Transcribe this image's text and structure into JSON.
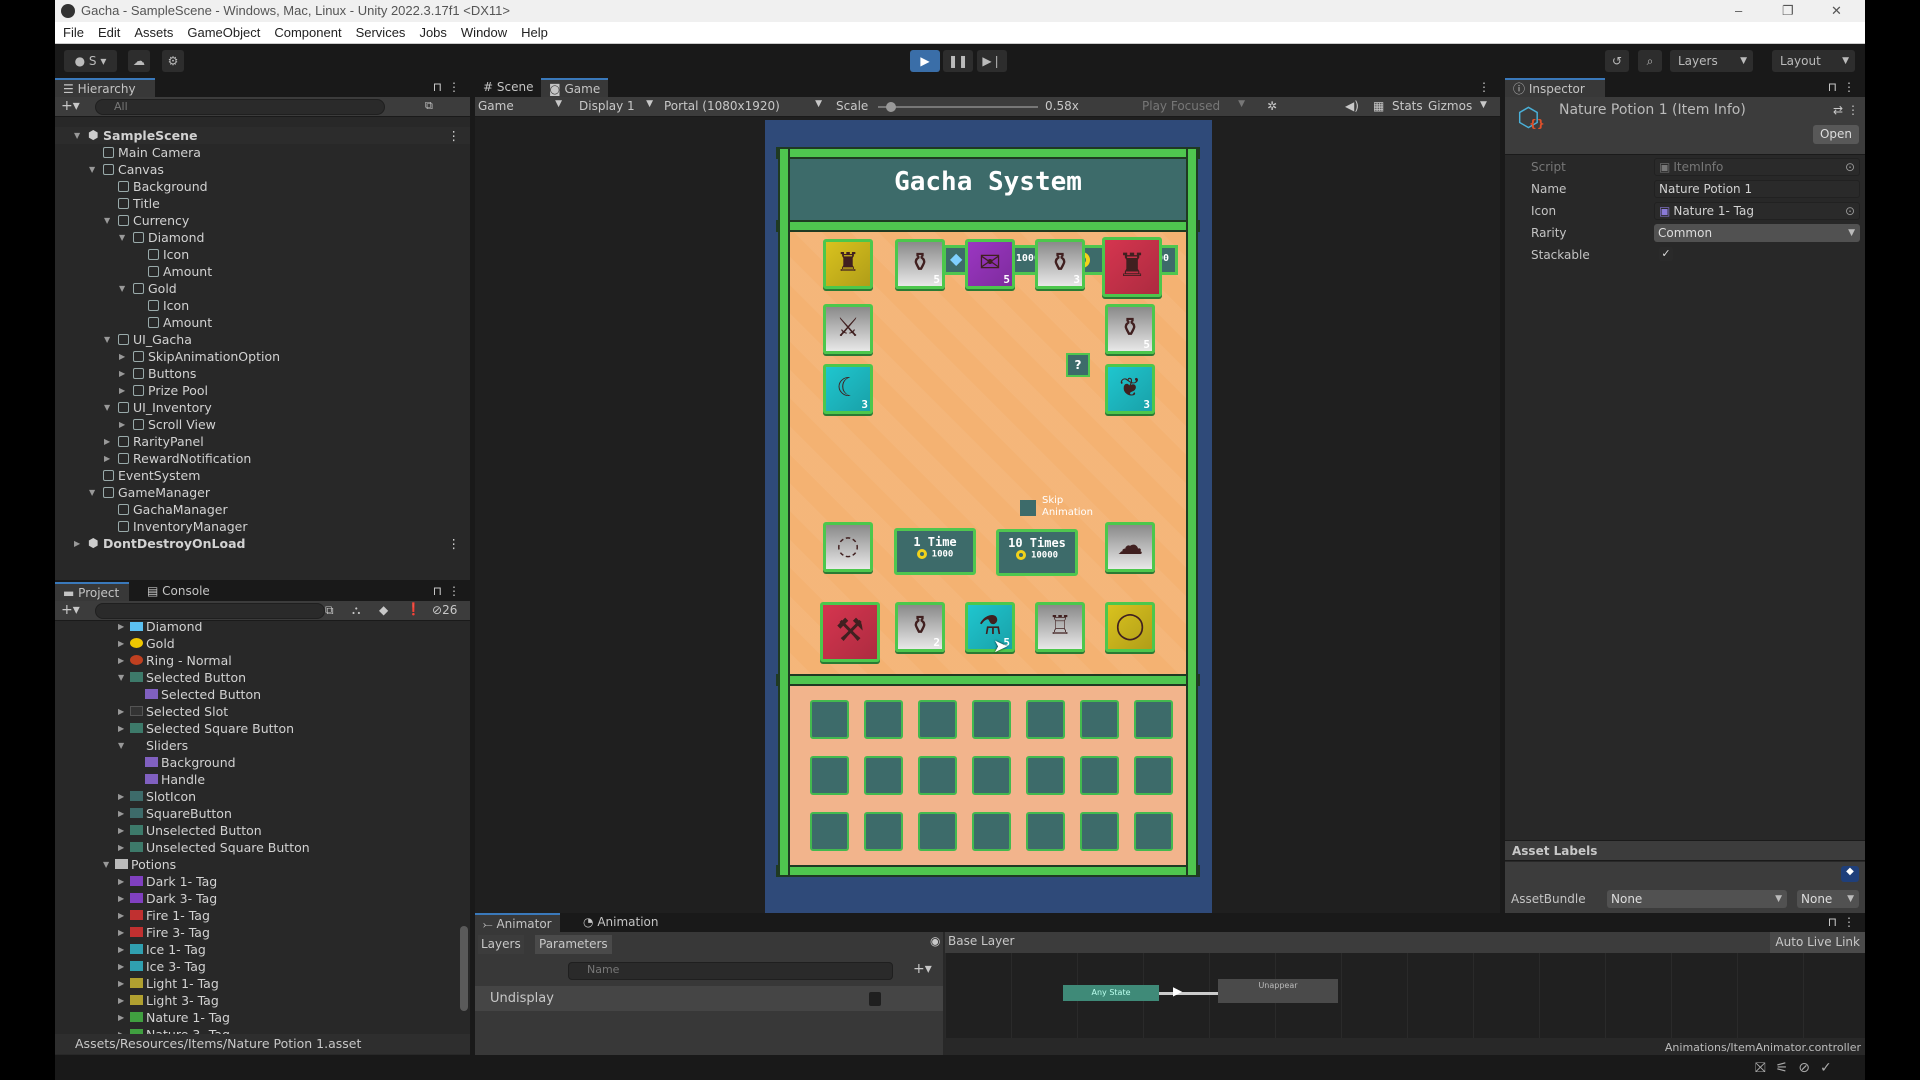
{
  "window": {
    "title": "Gacha - SampleScene - Windows, Mac, Linux - Unity 2022.3.17f1 <DX11>",
    "controls": [
      "–",
      "❐",
      "✕"
    ]
  },
  "menu": [
    "File",
    "Edit",
    "Assets",
    "GameObject",
    "Component",
    "Services",
    "Jobs",
    "Window",
    "Help"
  ],
  "toolbar": {
    "account": "S",
    "layers": "Layers",
    "layout": "Layout"
  },
  "hierarchy": {
    "tab": "Hierarchy",
    "search_placeholder": "All",
    "items": [
      {
        "label": "SampleScene",
        "depth": 0,
        "state": "open",
        "scene": true
      },
      {
        "label": "Main Camera",
        "depth": 1
      },
      {
        "label": "Canvas",
        "depth": 1,
        "state": "open"
      },
      {
        "label": "Background",
        "depth": 2
      },
      {
        "label": "Title",
        "depth": 2
      },
      {
        "label": "Currency",
        "depth": 2,
        "state": "open"
      },
      {
        "label": "Diamond",
        "depth": 3,
        "state": "open"
      },
      {
        "label": "Icon",
        "depth": 4
      },
      {
        "label": "Amount",
        "depth": 4
      },
      {
        "label": "Gold",
        "depth": 3,
        "state": "open"
      },
      {
        "label": "Icon",
        "depth": 4
      },
      {
        "label": "Amount",
        "depth": 4
      },
      {
        "label": "UI_Gacha",
        "depth": 2,
        "state": "open"
      },
      {
        "label": "SkipAnimationOption",
        "depth": 3,
        "state": "closed"
      },
      {
        "label": "Buttons",
        "depth": 3,
        "state": "closed"
      },
      {
        "label": "Prize Pool",
        "depth": 3,
        "state": "closed"
      },
      {
        "label": "UI_Inventory",
        "depth": 2,
        "state": "open"
      },
      {
        "label": "Scroll View",
        "depth": 3,
        "state": "closed"
      },
      {
        "label": "RarityPanel",
        "depth": 2,
        "state": "closed"
      },
      {
        "label": "RewardNotification",
        "depth": 2,
        "state": "closed"
      },
      {
        "label": "EventSystem",
        "depth": 1
      },
      {
        "label": "GameManager",
        "depth": 1,
        "state": "open"
      },
      {
        "label": "GachaManager",
        "depth": 2
      },
      {
        "label": "InventoryManager",
        "depth": 2
      },
      {
        "label": "DontDestroyOnLoad",
        "depth": 0,
        "state": "closed",
        "scene": true
      }
    ]
  },
  "game_view": {
    "tabs": [
      "Scene",
      "Game"
    ],
    "active_tab": "Game",
    "mode": "Game",
    "display": "Display 1",
    "resolution": "Portal (1080x1920)",
    "scale_label": "Scale",
    "scale": "0.58x",
    "scale_fraction": 0.05,
    "play_focused": "Play Focused",
    "stats": "Stats",
    "gizmos": "Gizmos"
  },
  "game": {
    "title": "Gacha System",
    "diamond_amount": "10000",
    "gold_amount": "20000",
    "help": "?",
    "skip_animation": "Skip Animation",
    "skip_checked": false,
    "pull_one": {
      "label": "1 Time",
      "cost": "1000"
    },
    "pull_ten": {
      "label": "10 Times",
      "cost": "10000"
    },
    "rarity_colors": {
      "legendary": "#d9c21e",
      "common": "#c4c4c4",
      "epic": "#9b36c2",
      "mythic": "#d5354f",
      "rare": "#1fc6cf"
    },
    "prizes": [
      {
        "icon": "golden-armor",
        "rarity": "legendary",
        "count": ""
      },
      {
        "icon": "dark-potion",
        "rarity": "common",
        "count": "5"
      },
      {
        "icon": "scroll-bundle",
        "rarity": "epic",
        "count": "5"
      },
      {
        "icon": "light-potion",
        "rarity": "common",
        "count": "3"
      },
      {
        "icon": "crimson-armor",
        "rarity": "mythic",
        "count": ""
      },
      {
        "icon": "sword",
        "rarity": "common",
        "count": ""
      },
      {
        "icon": "fire-potion",
        "rarity": "common",
        "count": "5"
      },
      {
        "icon": "dark-spellbook",
        "rarity": "rare",
        "count": "3"
      },
      {
        "icon": "nature-spellbook",
        "rarity": "rare",
        "count": "3"
      },
      {
        "icon": "necklace",
        "rarity": "common",
        "count": ""
      },
      {
        "icon": "ore",
        "rarity": "common",
        "count": ""
      },
      {
        "icon": "crimson-axe",
        "rarity": "mythic",
        "count": ""
      },
      {
        "icon": "nature-potion",
        "rarity": "common",
        "count": "2"
      },
      {
        "icon": "ice-potion",
        "rarity": "rare",
        "count": "5"
      },
      {
        "icon": "leather-armor",
        "rarity": "common",
        "count": ""
      },
      {
        "icon": "ruby-ring",
        "rarity": "legendary",
        "count": ""
      }
    ],
    "inventory_slots": 21
  },
  "inspector": {
    "tab": "Inspector",
    "title": "Nature Potion 1 (Item Info)",
    "open": "Open",
    "fields": [
      {
        "label": "Script",
        "value": "ItemInfo"
      },
      {
        "label": "Name",
        "value": "Nature Potion 1"
      },
      {
        "label": "Icon",
        "value": "Nature 1- Tag"
      },
      {
        "label": "Rarity",
        "value": "Common"
      },
      {
        "label": "Stackable",
        "checked": true
      }
    ],
    "asset_labels": "Asset Labels",
    "assetbundle_label": "AssetBundle",
    "assetbundle": "None",
    "variant": "None"
  },
  "project": {
    "tabs": [
      "Project",
      "Console"
    ],
    "hidden_count": "26",
    "items": [
      {
        "label": "Diamond",
        "depth": 1,
        "state": "closed",
        "icon": "diamond"
      },
      {
        "label": "Gold",
        "depth": 1,
        "state": "closed",
        "icon": "gold"
      },
      {
        "label": "Ring - Normal",
        "depth": 1,
        "state": "closed",
        "icon": "ring"
      },
      {
        "label": "Selected Button",
        "depth": 1,
        "state": "open",
        "icon": "button"
      },
      {
        "label": "Selected Button",
        "depth": 2,
        "icon": "sprite"
      },
      {
        "label": "Selected Slot",
        "depth": 1,
        "state": "closed",
        "icon": "slot"
      },
      {
        "label": "Selected Square Button",
        "depth": 1,
        "state": "closed",
        "icon": "button"
      },
      {
        "label": "Sliders",
        "depth": 1,
        "state": "open",
        "icon": "none"
      },
      {
        "label": "Background",
        "depth": 2,
        "icon": "sprite"
      },
      {
        "label": "Handle",
        "depth": 2,
        "icon": "sprite"
      },
      {
        "label": "SlotIcon",
        "depth": 1,
        "state": "closed",
        "icon": "square"
      },
      {
        "label": "SquareButton",
        "depth": 1,
        "state": "closed",
        "icon": "square"
      },
      {
        "label": "Unselected Button",
        "depth": 1,
        "state": "closed",
        "icon": "button"
      },
      {
        "label": "Unselected Square Button",
        "depth": 1,
        "state": "closed",
        "icon": "button"
      },
      {
        "label": "Potions",
        "depth": 0,
        "state": "open",
        "icon": "folder"
      },
      {
        "label": "Dark 1- Tag",
        "depth": 1,
        "state": "closed",
        "icon": "potion-dark"
      },
      {
        "label": "Dark 3- Tag",
        "depth": 1,
        "state": "closed",
        "icon": "potion-dark"
      },
      {
        "label": "Fire 1- Tag",
        "depth": 1,
        "state": "closed",
        "icon": "potion-fire"
      },
      {
        "label": "Fire 3- Tag",
        "depth": 1,
        "state": "closed",
        "icon": "potion-fire"
      },
      {
        "label": "Ice 1- Tag",
        "depth": 1,
        "state": "closed",
        "icon": "potion-ice"
      },
      {
        "label": "Ice 3- Tag",
        "depth": 1,
        "state": "closed",
        "icon": "potion-ice"
      },
      {
        "label": "Light 1- Tag",
        "depth": 1,
        "state": "closed",
        "icon": "potion-light"
      },
      {
        "label": "Light 3- Tag",
        "depth": 1,
        "state": "closed",
        "icon": "potion-light"
      },
      {
        "label": "Nature 1- Tag",
        "depth": 1,
        "state": "closed",
        "icon": "potion-nature"
      },
      {
        "label": "Nature 3- Tag",
        "depth": 1,
        "state": "closed",
        "icon": "potion-nature"
      }
    ],
    "path": "Assets/Resources/Items/Nature Potion 1.asset"
  },
  "animator": {
    "tabs": [
      "Animator",
      "Animation"
    ],
    "subtabs": [
      "Layers",
      "Parameters"
    ],
    "breadcrumb": "Base Layer",
    "auto_live_link": "Auto Live Link",
    "search_placeholder": "Name",
    "parameter": "Undisplay",
    "parameter_value": false,
    "states": [
      "Any State",
      "Unappear"
    ],
    "controller_path": "Animations/ItemAnimator.controller"
  }
}
